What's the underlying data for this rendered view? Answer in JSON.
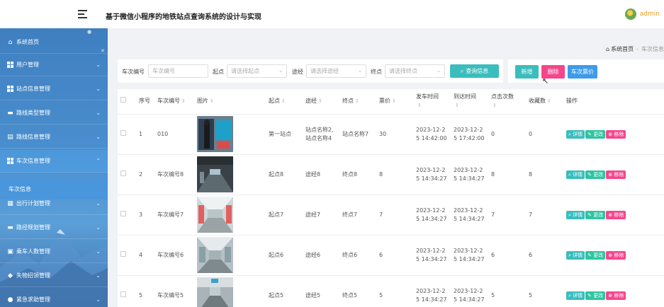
{
  "app": {
    "title": "基于微信小程序的地铁站点查询系统的设计与实现",
    "user": "admin"
  },
  "sidebar": {
    "items": [
      {
        "label": "系统首页",
        "icon": "home-icon"
      },
      {
        "label": "用户管理",
        "icon": "grid-icon"
      },
      {
        "label": "站点信息管理",
        "icon": "grid-icon"
      },
      {
        "label": "路线类型管理",
        "icon": "book-icon"
      },
      {
        "label": "路线信息管理",
        "icon": "chart-icon"
      },
      {
        "label": "车次信息管理",
        "icon": "grid-icon"
      },
      {
        "label": "出行计划管理",
        "icon": "table-icon"
      },
      {
        "label": "路径规划管理",
        "icon": "comment-icon"
      },
      {
        "label": "乘车人数管理",
        "icon": "briefcase-icon"
      },
      {
        "label": "失物招领管理",
        "icon": "tag-icon"
      },
      {
        "label": "紧急求助管理",
        "icon": "person-icon"
      }
    ],
    "active_sub": "车次信息"
  },
  "breadcrumb": {
    "home": "系统首页",
    "current": "车次信息"
  },
  "search": {
    "fields": [
      {
        "label": "车次编号",
        "placeholder": "车次编号"
      },
      {
        "label": "起点",
        "placeholder": "请选择起点"
      },
      {
        "label": "途经",
        "placeholder": "请选择途经"
      },
      {
        "label": "终点",
        "placeholder": "请选择终点"
      }
    ],
    "query_button": "查询信息"
  },
  "actions": {
    "add": "新增",
    "delete": "删除",
    "price": "车次票价"
  },
  "table": {
    "headers": [
      "序号",
      "车次编号",
      "图片",
      "起点",
      "途经",
      "终点",
      "票价",
      "发车时间",
      "到达时间",
      "点击次数",
      "收藏数",
      "操作"
    ],
    "rows": [
      {
        "no": "1",
        "code": "010",
        "start": "第一站点",
        "via": "站点名称2,站点名称4",
        "end": "站点名称7",
        "price": "30",
        "depart": "2023-12-25 14:42:00",
        "arrive": "2023-12-25 17:42:00",
        "clicks": "0",
        "favs": "0"
      },
      {
        "no": "2",
        "code": "车次编号8",
        "start": "起点8",
        "via": "途经8",
        "end": "终点8",
        "price": "8",
        "depart": "2023-12-25 14:34:27",
        "arrive": "2023-12-25 14:34:27",
        "clicks": "8",
        "favs": "8"
      },
      {
        "no": "3",
        "code": "车次编号7",
        "start": "起点7",
        "via": "途经7",
        "end": "终点7",
        "price": "7",
        "depart": "2023-12-25 14:34:27",
        "arrive": "2023-12-25 14:34:27",
        "clicks": "7",
        "favs": "7"
      },
      {
        "no": "4",
        "code": "车次编号6",
        "start": "起点6",
        "via": "途经6",
        "end": "终点6",
        "price": "6",
        "depart": "2023-12-25 14:34:27",
        "arrive": "2023-12-25 14:34:27",
        "clicks": "6",
        "favs": "6"
      },
      {
        "no": "5",
        "code": "车次编号5",
        "start": "起点5",
        "via": "途经5",
        "end": "终点5",
        "price": "5",
        "depart": "2023-12-25 14:34:27",
        "arrive": "2023-12-25 14:34:27",
        "clicks": "5",
        "favs": "5"
      }
    ],
    "op_labels": {
      "detail": "详情",
      "edit": "更改",
      "remove": "移除"
    }
  },
  "colors": {
    "accent_teal": "#3bbdbd",
    "danger_pink": "#f5468c",
    "primary_blue": "#3d9be9",
    "sidebar_blue": "#4a8fcf"
  }
}
